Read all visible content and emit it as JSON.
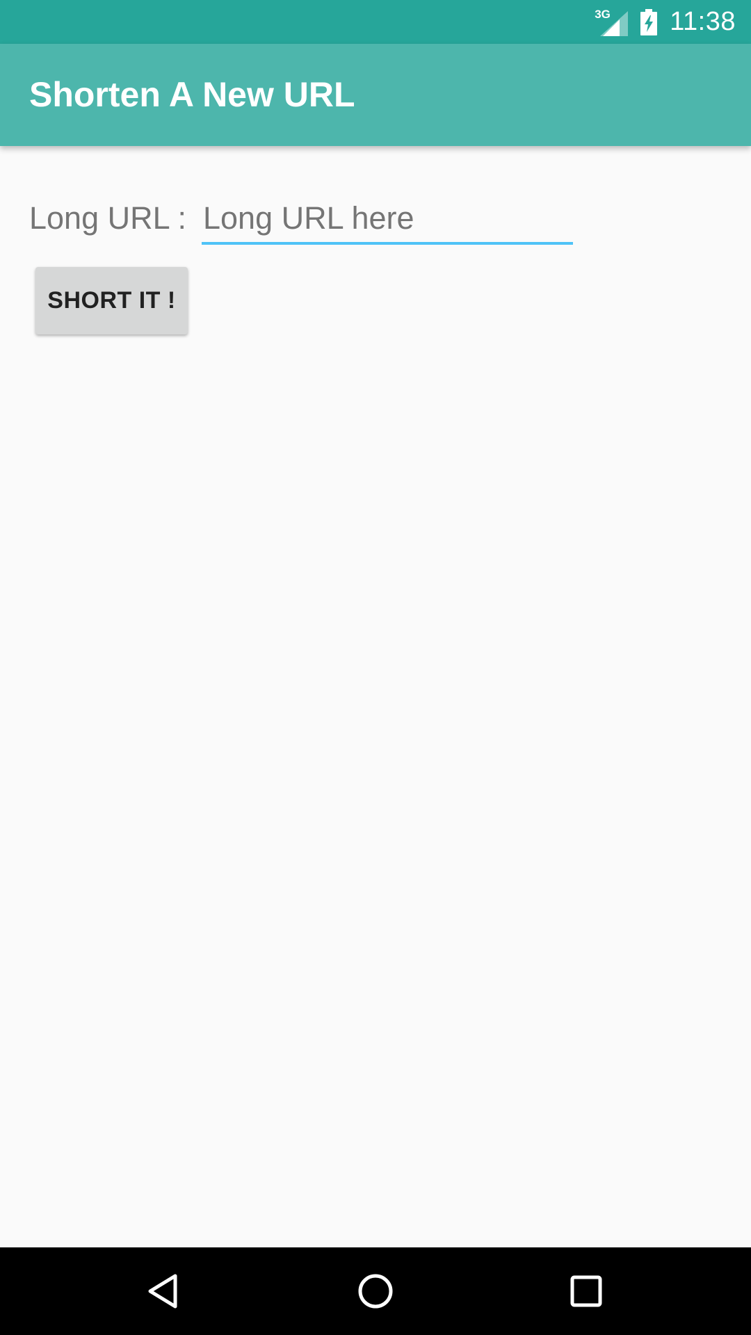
{
  "status_bar": {
    "network_type": "3G",
    "time": "11:38",
    "icons": [
      "signal-icon",
      "battery-charging-icon"
    ]
  },
  "app_bar": {
    "title": "Shorten A New URL",
    "color": "#4db6ac"
  },
  "form": {
    "label": "Long URL :",
    "input_value": "",
    "input_placeholder": "Long URL here",
    "button_label": "SHORT IT !"
  },
  "nav_bar": {
    "icons": [
      "back-icon",
      "home-icon",
      "recents-icon"
    ]
  },
  "colors": {
    "status_bar": "#26a69a",
    "app_bar": "#4db6ac",
    "accent_underline": "#4fc3f7",
    "background": "#fafafa"
  }
}
